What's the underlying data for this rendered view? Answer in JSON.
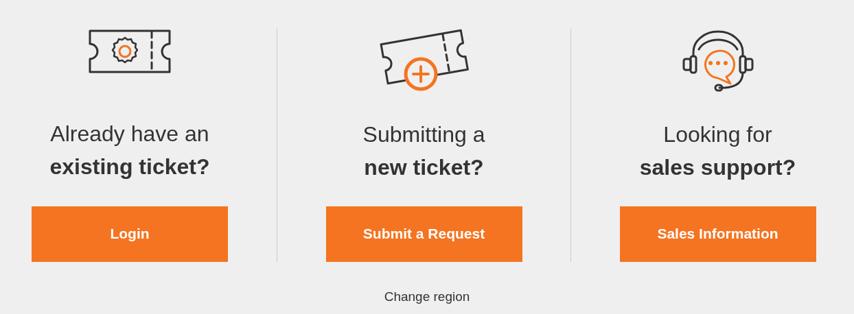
{
  "options": [
    {
      "kind": "existing",
      "heading": "Already have an **existing ticket?**",
      "button": "Login"
    },
    {
      "kind": "new",
      "heading": "Submitting a **new ticket?**",
      "button": "Submit a Request"
    },
    {
      "kind": "sales",
      "heading": "Looking for **sales support?**",
      "button": "Sales Information"
    }
  ],
  "footer_link": "Change region"
}
